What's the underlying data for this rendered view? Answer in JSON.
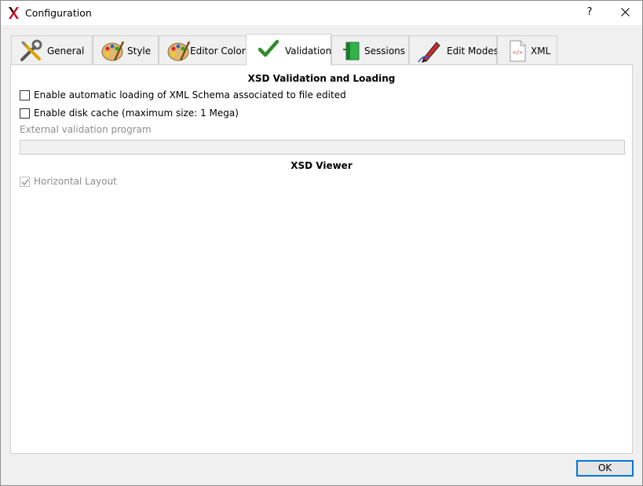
{
  "window": {
    "title": "Configuration",
    "help_label": "?"
  },
  "tabs": [
    {
      "label": "General",
      "icon": "tools-icon"
    },
    {
      "label": "Style",
      "icon": "palette-icon"
    },
    {
      "label": "Editor Colors",
      "icon": "palette-icon"
    },
    {
      "label": "Validation",
      "icon": "checkmark-icon",
      "active": true
    },
    {
      "label": "Sessions",
      "icon": "green-document-icon"
    },
    {
      "label": "Edit Modes",
      "icon": "pen-icon"
    },
    {
      "label": "XML",
      "icon": "xml-document-icon"
    }
  ],
  "validation": {
    "section_title": "XSD Validation and Loading",
    "auto_load_label": "Enable automatic loading of XML Schema associated to file edited",
    "auto_load_checked": false,
    "disk_cache_label": "Enable disk cache (maximum size: 1 Mega)",
    "disk_cache_checked": false,
    "external_program_label": "External validation program",
    "external_program_value": ""
  },
  "viewer": {
    "section_title": "XSD Viewer",
    "horizontal_layout_label": "Horizontal Layout",
    "horizontal_layout_checked": true
  },
  "footer": {
    "ok_label": "OK"
  },
  "colors": {
    "accent": "#0078d7",
    "check_green": "#2e8b2e"
  }
}
